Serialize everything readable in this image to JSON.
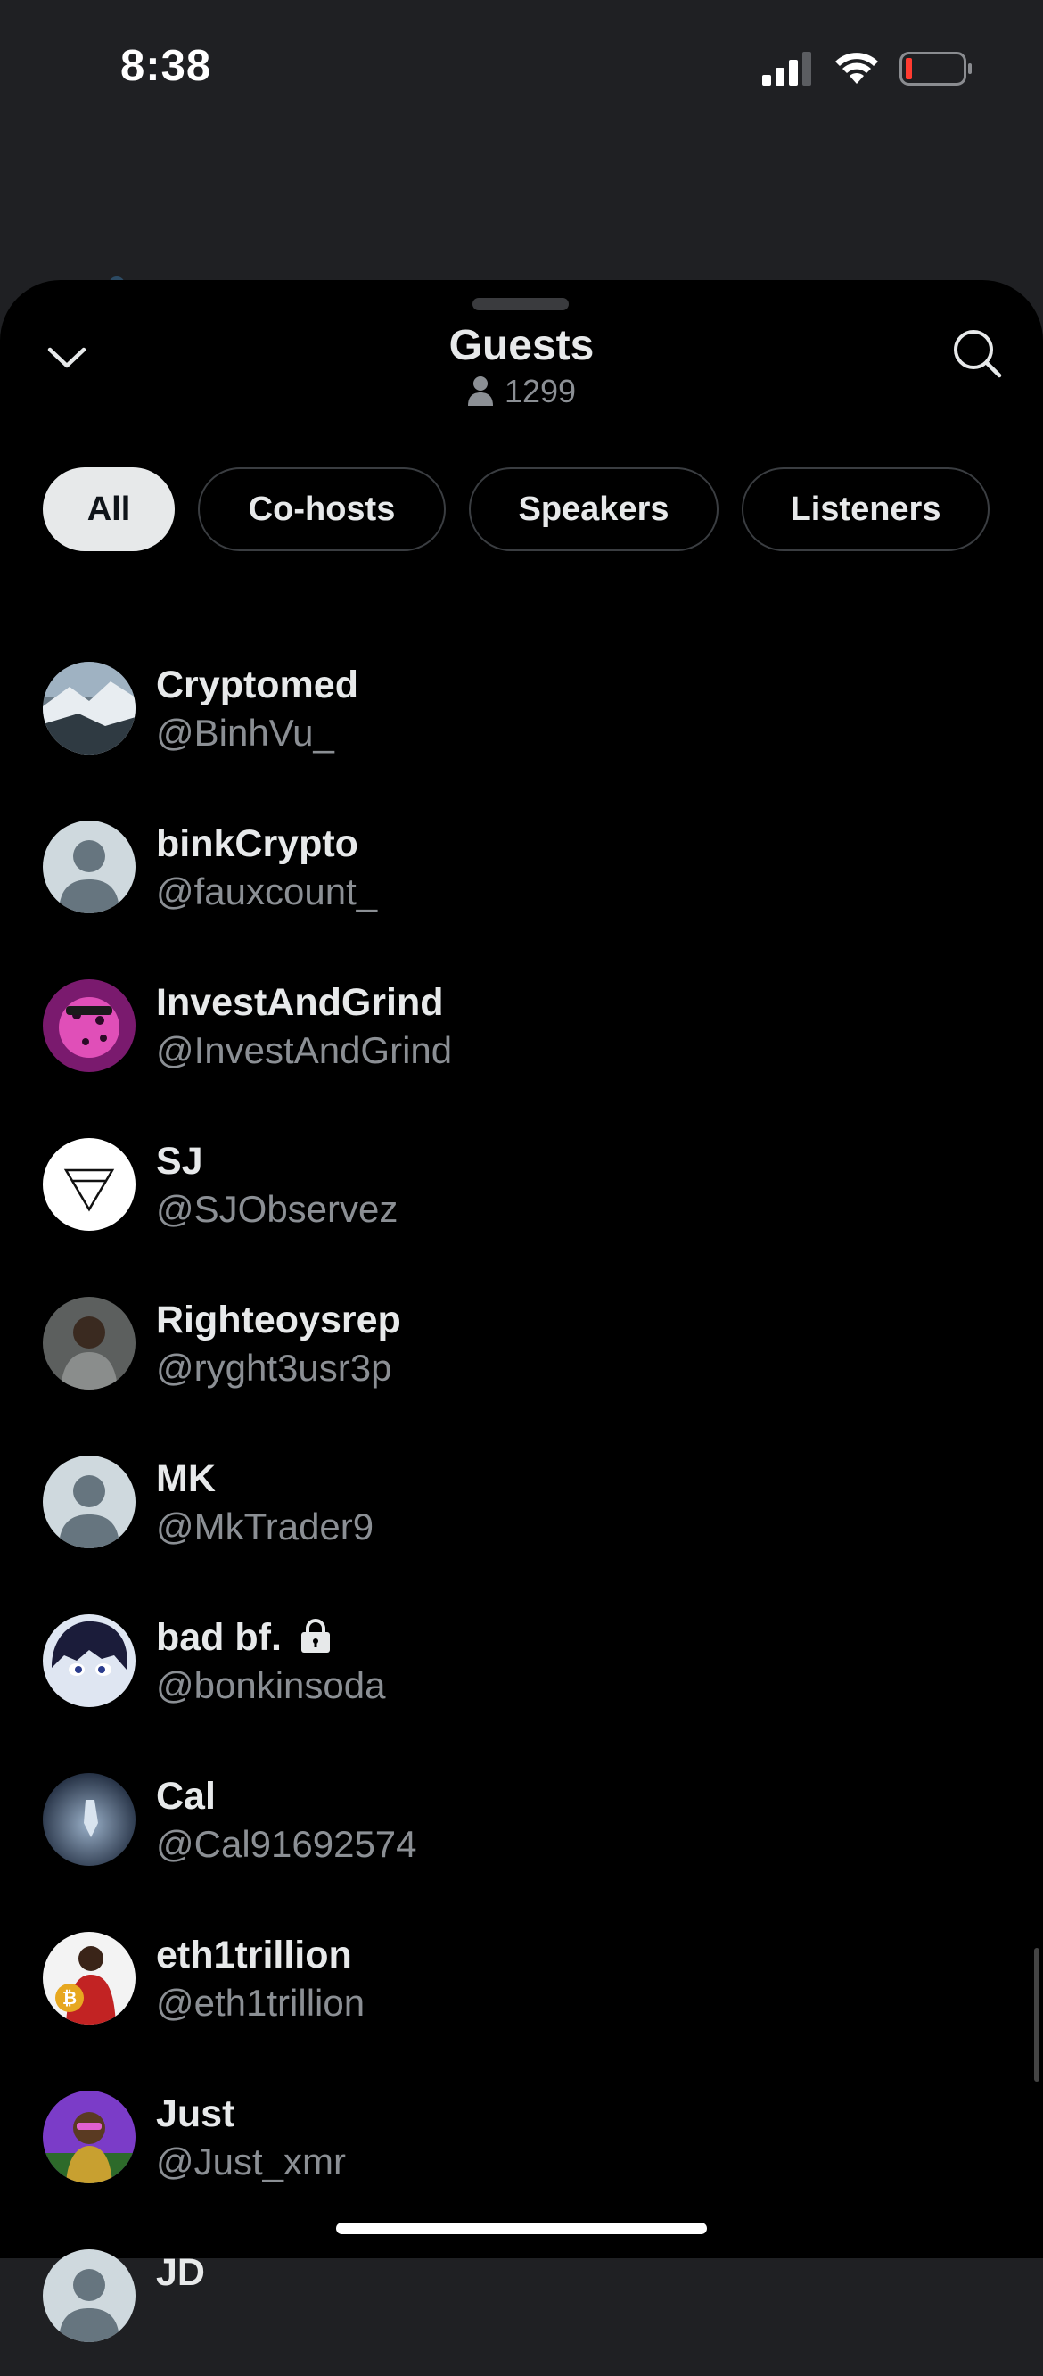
{
  "status": {
    "time": "8:38"
  },
  "sheet": {
    "title": "Guests",
    "listener_count": "1299"
  },
  "filters": [
    "All",
    "Co-hosts",
    "Speakers",
    "Listeners"
  ],
  "guests": [
    {
      "name": "Cryptomed",
      "handle": "@BinhVu_",
      "avatar": "landscape"
    },
    {
      "name": "binkCrypto",
      "handle": "@fauxcount_",
      "avatar": "default"
    },
    {
      "name": "InvestAndGrind",
      "handle": "@InvestAndGrind",
      "avatar": "pink-leopard"
    },
    {
      "name": "SJ",
      "handle": "@SJObservez",
      "avatar": "triangle-logo"
    },
    {
      "name": "Righteoysrep",
      "handle": "@ryght3usr3p",
      "avatar": "photo-child"
    },
    {
      "name": "MK",
      "handle": "@MkTrader9",
      "avatar": "default"
    },
    {
      "name": "bad bf.",
      "handle": "@bonkinsoda",
      "avatar": "anime",
      "protected": true
    },
    {
      "name": "Cal",
      "handle": "@Cal91692574",
      "avatar": "space"
    },
    {
      "name": "eth1trillion",
      "handle": "@eth1trillion",
      "avatar": "bitcoin-person"
    },
    {
      "name": "Just",
      "handle": "@Just_xmr",
      "avatar": "purple-art"
    },
    {
      "name": "JD",
      "handle": "",
      "avatar": "default"
    }
  ]
}
